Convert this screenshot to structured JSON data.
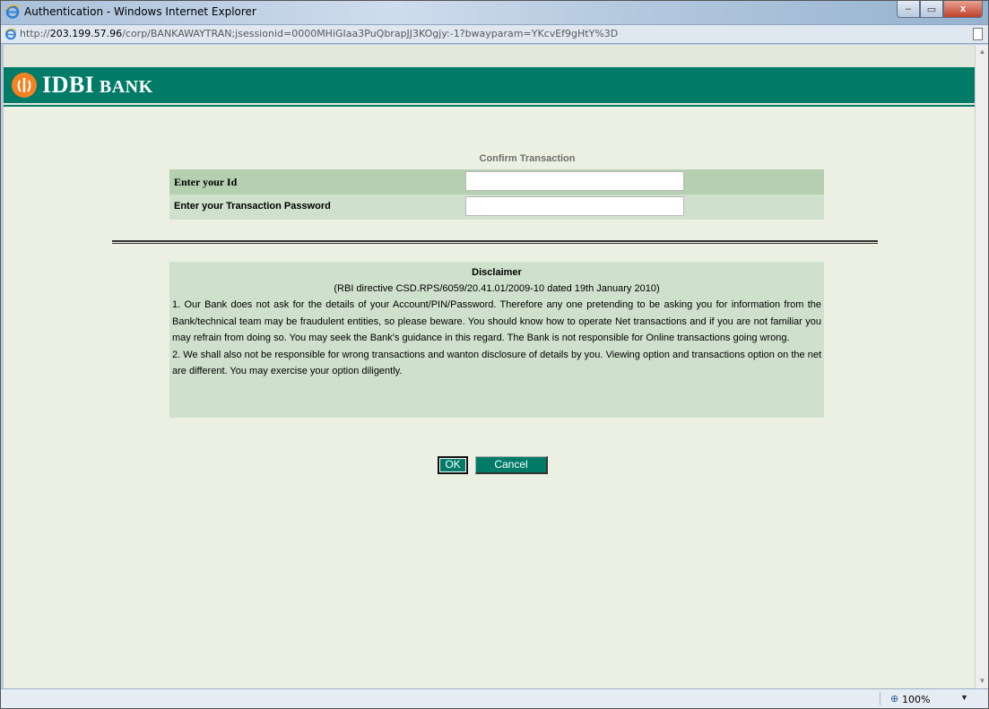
{
  "window": {
    "title": "Authentication - Windows Internet Explorer",
    "min_glyph": "–",
    "max_glyph": "▭",
    "close_glyph": "x"
  },
  "address": {
    "prefix": "http://",
    "host": "203.199.57.96",
    "path": "/corp/BANKAWAYTRAN;jsessionid=0000MHiGIaa3PuQbrapJJ3KOgjy:-1?bwayparam=YKcvEf9gHtY%3D"
  },
  "brand": {
    "name_main": "IDBI",
    "name_small": " BANK",
    "color_primary": "#007b68",
    "color_logo": "#f58220"
  },
  "form": {
    "title": "Confirm Transaction",
    "id_label": "Enter your Id",
    "id_value": "",
    "password_label": "Enter your Transaction Password",
    "password_value": ""
  },
  "disclaimer": {
    "title": "Disclaimer",
    "subtitle": "(RBI directive CSD.RPS/6059/20.41.01/2009-10 dated 19th January 2010)",
    "para1": "1. Our Bank does not ask for the details of your Account/PIN/Password. Therefore any one pretending to be asking you for information from the Bank/technical team may be fraudulent entities, so please beware. You should know how to operate Net transactions and if you are not familiar you may refrain from doing so. You may seek the Bank's guidance in this regard. The Bank is not responsible for Online transactions going wrong.",
    "para2": "2. We shall also not be responsible for wrong transactions and wanton disclosure of details by you. Viewing option and transactions option on the net are different. You may exercise your option diligently."
  },
  "buttons": {
    "ok": "OK",
    "cancel": "Cancel"
  },
  "status": {
    "zoom": "100%"
  },
  "icons": {
    "ie": "ie-logo-icon",
    "zoom": "zoom-icon",
    "page": "page-icon"
  }
}
